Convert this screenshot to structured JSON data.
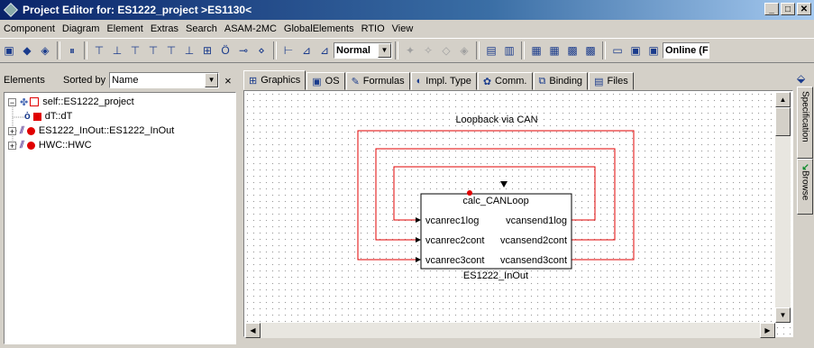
{
  "window": {
    "title": "Project Editor for: ES1222_project >ES1130<",
    "buttons": [
      "_",
      "□",
      "✕"
    ]
  },
  "menu": [
    "Component",
    "Diagram",
    "Element",
    "Extras",
    "Search",
    "ASAM-2MC",
    "GlobalElements",
    "RTIO",
    "View"
  ],
  "toolbar": {
    "mode_value": "Normal",
    "online_value": "Online (F"
  },
  "left_panel": {
    "label": "Elements",
    "sorted_label": "Sorted by",
    "sort_value": "Name",
    "close": "×",
    "tree": [
      {
        "label": "self::ES1222_project",
        "expander": "−",
        "icon": "project-icon"
      },
      {
        "label": "dT::dT",
        "expander": "",
        "icon": "dt-icon"
      },
      {
        "label": "ES1222_InOut::ES1222_InOut",
        "expander": "+",
        "icon": "module-icon"
      },
      {
        "label": "HWC::HWC",
        "expander": "+",
        "icon": "module-icon"
      }
    ]
  },
  "tabs": [
    {
      "label": "Graphics",
      "icon": "graphics-icon"
    },
    {
      "label": "OS",
      "icon": "os-icon"
    },
    {
      "label": "Formulas",
      "icon": "formulas-icon"
    },
    {
      "label": "Impl. Type",
      "icon": "impl-type-icon"
    },
    {
      "label": "Comm.",
      "icon": "comm-icon"
    },
    {
      "label": "Binding",
      "icon": "binding-icon"
    },
    {
      "label": "Files",
      "icon": "files-icon"
    }
  ],
  "diagram": {
    "annotation": "Loopback via CAN",
    "block": {
      "process": "calc_CANLoop",
      "name": "ES1222_InOut",
      "inputs": [
        "vcanrec1log",
        "vcanrec2cont",
        "vcanrec3cont"
      ],
      "outputs": [
        "vcansend1log",
        "vcansend2cont",
        "vcansend3cont"
      ]
    },
    "wire_color": "#e00000"
  },
  "side_tabs": [
    "Specification",
    "Browse"
  ]
}
